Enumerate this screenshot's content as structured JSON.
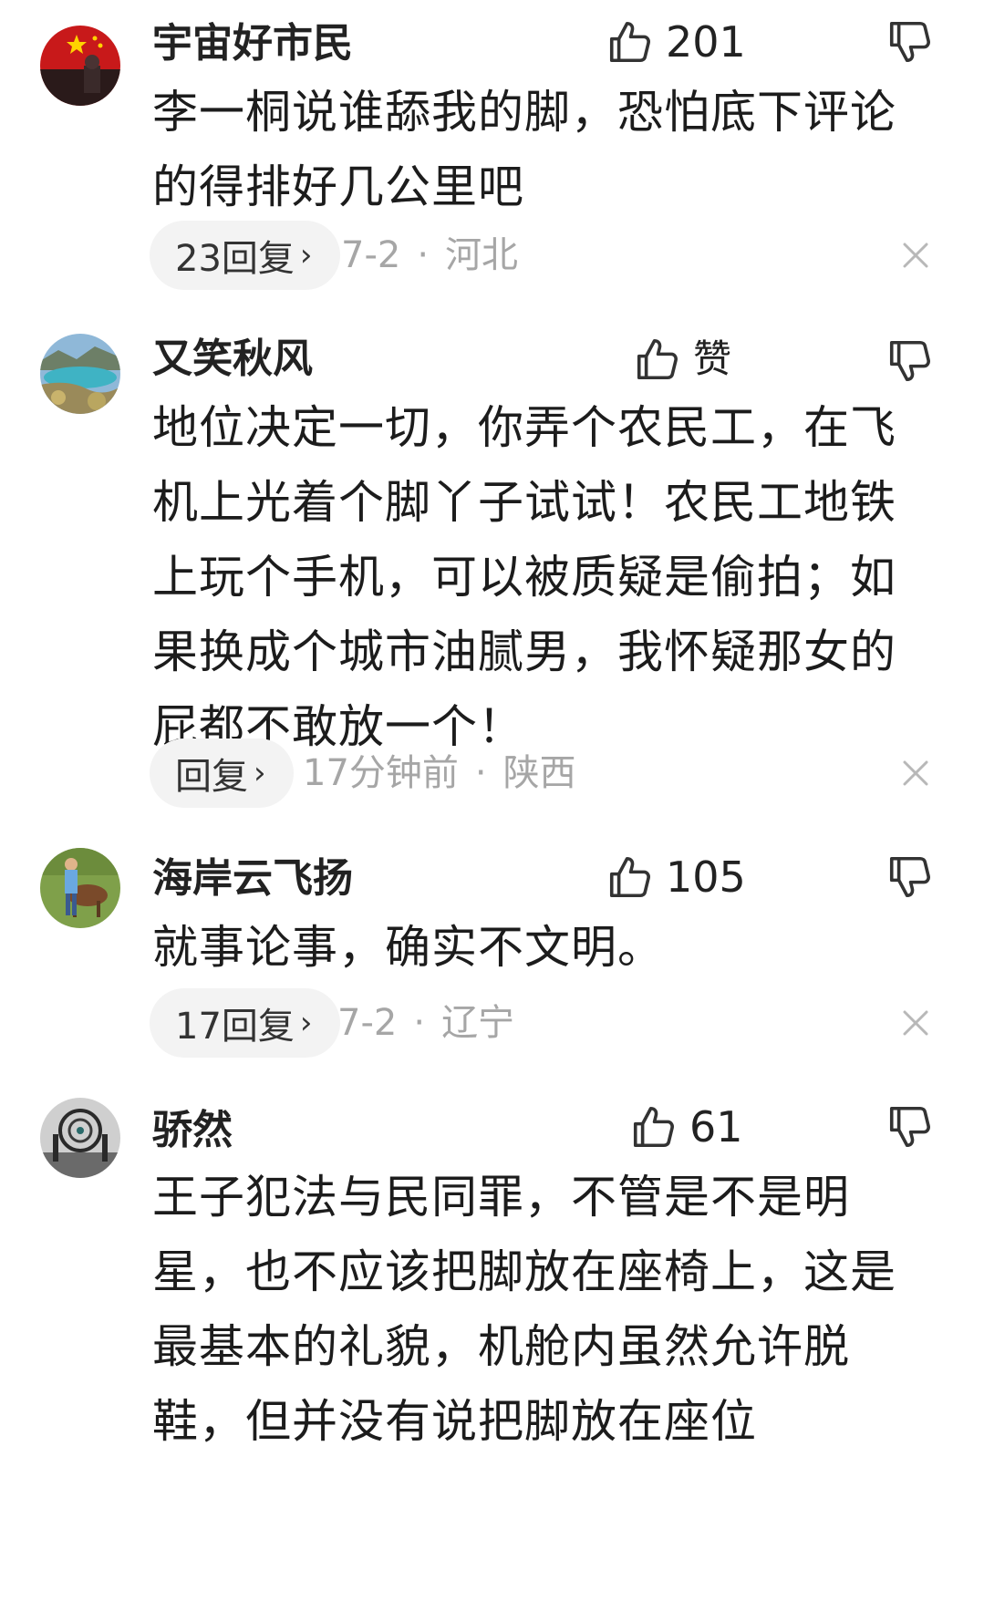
{
  "comments": [
    {
      "username": "宇宙好市民",
      "likes": "201",
      "text": "李一桐说谁舔我的脚，恐怕底下评论的得排好几公里吧",
      "reply_label": "23回复",
      "date": "7-2",
      "location": "河北"
    },
    {
      "username": "又笑秋风",
      "likes": "赞",
      "text": "地位决定一切，你弄个农民工，在飞机上光着个脚丫子试试！农民工地铁上玩个手机，可以被质疑是偷拍；如果换成个城市油腻男，我怀疑那女的屁都不敢放一个！",
      "reply_label": "回复",
      "date": "17分钟前",
      "location": "陕西"
    },
    {
      "username": "海岸云飞扬",
      "likes": "105",
      "text": "就事论事，确实不文明。",
      "reply_label": "17回复",
      "date": "7-2",
      "location": "辽宁"
    },
    {
      "username": "骄然",
      "likes": "61",
      "text": "王子犯法与民同罪，不管是不是明星，也不应该把脚放在座椅上，这是最基本的礼貌，机舱内虽然允许脱鞋，但并没有说把脚放在座位"
    }
  ],
  "icons": {
    "like": "thumbs-up-icon",
    "dislike": "thumbs-down-icon",
    "chevron": "chevron-right-icon",
    "close": "close-icon"
  },
  "separator": "·",
  "chevron_glyph": "›"
}
